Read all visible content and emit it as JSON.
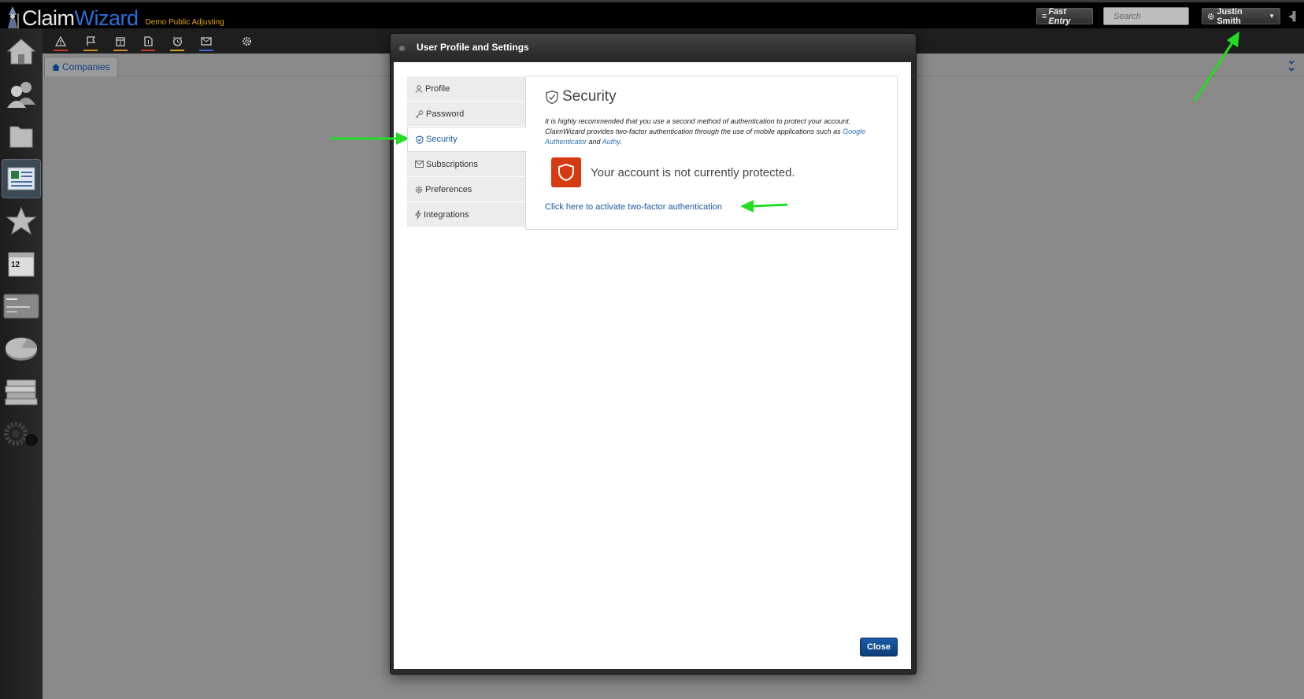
{
  "app": {
    "logo_claim": "Claim",
    "logo_wizard": "Wizard",
    "company": "Demo Public Adjusting"
  },
  "header": {
    "fast_entry_label": "Fast Entry",
    "search_placeholder": "Search",
    "user_name": "Justin Smith"
  },
  "sidebar": {
    "items": [
      {
        "icon": "home-icon"
      },
      {
        "icon": "contacts-icon"
      },
      {
        "icon": "folder-icon"
      },
      {
        "icon": "companies-icon",
        "active": true
      },
      {
        "icon": "star-icon"
      },
      {
        "icon": "calendar-icon",
        "day": "12"
      },
      {
        "icon": "card-icon"
      },
      {
        "icon": "pie-chart-icon"
      },
      {
        "icon": "books-icon"
      },
      {
        "icon": "gears-icon"
      }
    ]
  },
  "toolbar": {
    "icons": [
      "alert-icon",
      "flag-icon",
      "calendar-icon",
      "document-icon",
      "alarm-icon",
      "mail-icon",
      "settings-icon"
    ],
    "underline_colors": [
      "#c0392b",
      "#d08a2a",
      "#d08a2a",
      "#c0392b",
      "#d4a017",
      "#3b6fd6"
    ]
  },
  "tabs": {
    "companies_label": "Companies"
  },
  "modal": {
    "title": "User Profile and Settings",
    "menu": [
      {
        "label": "Profile",
        "icon": "user-icon"
      },
      {
        "label": "Password",
        "icon": "key-icon"
      },
      {
        "label": "Security",
        "icon": "shield-icon",
        "active": true
      },
      {
        "label": "Subscriptions",
        "icon": "envelope-icon"
      },
      {
        "label": "Preferences",
        "icon": "gear-icon"
      },
      {
        "label": "Integrations",
        "icon": "bolt-icon"
      }
    ],
    "security": {
      "heading": "Security",
      "intro_part1": "It is highly recommended that you use a second method of authentication to protect your account. ClaimWizard provides two-factor authentication through the use of mobile applications such as ",
      "link_google": "Google Authenticator",
      "intro_and": " and ",
      "link_authy": "Authy",
      "intro_end": ".",
      "status_text": "Your account is not currently protected.",
      "activate_link": "Click here to activate two-factor authentication"
    },
    "close_label": "Close"
  },
  "colors": {
    "accent": "#1c58a4",
    "danger": "#d63a10",
    "annotation": "#22dd22"
  }
}
